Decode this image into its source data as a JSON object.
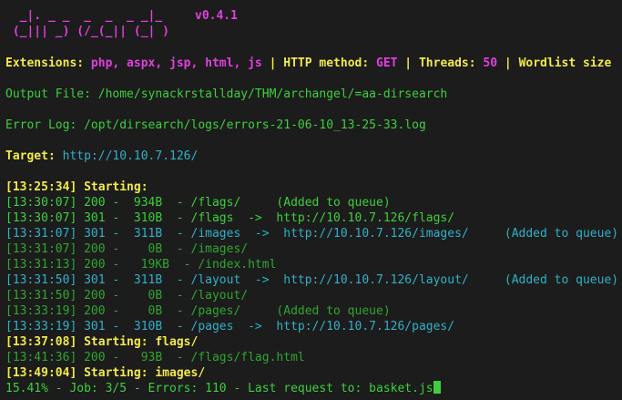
{
  "banner": {
    "logo_line1": "  _|. _ _  _  _  _ _|_    ",
    "logo_line2": " (_||| _) (/_(_|| (_| )   ",
    "version": "v0.4.1"
  },
  "config": {
    "ext_label": "Extensions: ",
    "ext_value": "php, aspx, jsp, html, js",
    "sep": " | ",
    "method_label": "HTTP method: ",
    "method_value": "GET",
    "threads_label": "Threads: ",
    "threads_value": "50",
    "wordlist_label": "Wordlist size"
  },
  "output_file": "Output File: /home/synackrstallday/THM/archangel/=aa-dirsearch",
  "error_log": "Error Log: /opt/dirsearch/logs/errors-21-06-10_13-25-33.log",
  "target": {
    "label": "Target: ",
    "url": "http://10.10.7.126/"
  },
  "log": [
    {
      "text": "[13:25:34] Starting:",
      "style": "yb"
    },
    {
      "text": "[13:30:07] 200 -  934B  - /flags/     (Added to queue)",
      "style": "g"
    },
    {
      "text": "[13:30:07] 301 -  310B  - /flags  ->  http://10.10.7.126/flags/",
      "style": "g"
    },
    {
      "text": "[13:31:07] 301 -  311B  - /images  ->  http://10.10.7.126/images/     (Added to queue)",
      "style": "c"
    },
    {
      "text": "[13:31:07] 200 -    0B  - /images/",
      "style": "gd"
    },
    {
      "text": "[13:31:13] 200 -   19KB  - /index.html",
      "style": "gd"
    },
    {
      "text": "[13:31:50] 301 -  311B  - /layout  ->  http://10.10.7.126/layout/     (Added to queue)",
      "style": "c"
    },
    {
      "text": "[13:31:50] 200 -    0B  - /layout/",
      "style": "gd"
    },
    {
      "text": "[13:33:19] 200 -    0B  - /pages/     (Added to queue)",
      "style": "gd"
    },
    {
      "text": "[13:33:19] 301 -  310B  - /pages  ->  http://10.10.7.126/pages/",
      "style": "c"
    },
    {
      "text": "[13:37:08] Starting: flags/",
      "style": "yb"
    },
    {
      "text": "[13:41:36] 200 -   93B  - /flags/flag.html",
      "style": "gd"
    },
    {
      "text": "[13:49:04] Starting: images/",
      "style": "yb"
    }
  ],
  "status": "15.41% - Job: 3/5 - Errors: 110 - Last request to: basket.js",
  "colors": {
    "background": "#1c1c1c",
    "yellow": "#f2e94e",
    "magenta": "#e040e0",
    "green": "#3ecf3e",
    "cyan": "#32b0c8"
  }
}
